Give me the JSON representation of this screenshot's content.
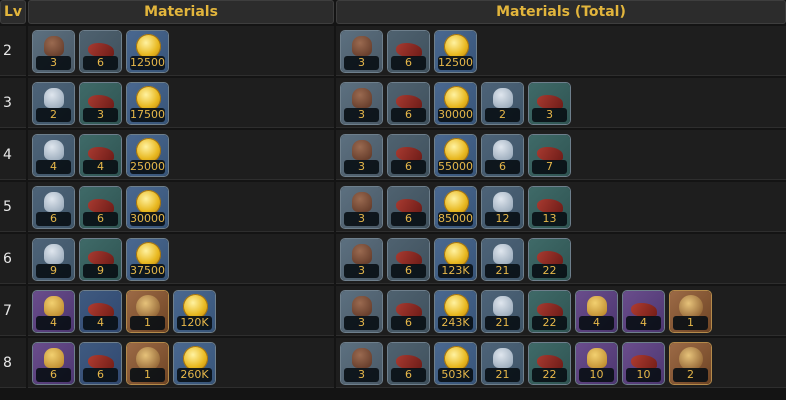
{
  "header": {
    "lv": "Lv",
    "materials": "Materials",
    "total": "Materials (Total)"
  },
  "rows": [
    {
      "lv": "2",
      "materials": [
        {
          "icon": "helmet-bronze-icon",
          "style": "helmet",
          "qty": "3"
        },
        {
          "icon": "red-boot-icon",
          "style": "boot",
          "qty": "6"
        },
        {
          "icon": "gold-coin-icon",
          "style": "coin",
          "qty": "12500"
        }
      ],
      "total": [
        {
          "icon": "helmet-bronze-icon",
          "style": "helmet",
          "qty": "3"
        },
        {
          "icon": "red-boot-icon",
          "style": "boot",
          "qty": "6"
        },
        {
          "icon": "gold-coin-icon",
          "style": "coin",
          "qty": "12500"
        }
      ]
    },
    {
      "lv": "3",
      "materials": [
        {
          "icon": "helmet-silver-icon",
          "style": "helmet-s",
          "qty": "2"
        },
        {
          "icon": "red-boot-teal-icon",
          "style": "boot-t",
          "qty": "3"
        },
        {
          "icon": "gold-coin-icon",
          "style": "coin",
          "qty": "17500"
        }
      ],
      "total": [
        {
          "icon": "helmet-bronze-icon",
          "style": "helmet",
          "qty": "3"
        },
        {
          "icon": "red-boot-icon",
          "style": "boot",
          "qty": "6"
        },
        {
          "icon": "gold-coin-icon",
          "style": "coin",
          "qty": "30000"
        },
        {
          "icon": "helmet-silver-icon",
          "style": "helmet-s",
          "qty": "2"
        },
        {
          "icon": "red-boot-teal-icon",
          "style": "boot-t",
          "qty": "3"
        }
      ]
    },
    {
      "lv": "4",
      "materials": [
        {
          "icon": "helmet-silver-icon",
          "style": "helmet-s",
          "qty": "4"
        },
        {
          "icon": "red-boot-teal-icon",
          "style": "boot-t",
          "qty": "4"
        },
        {
          "icon": "gold-coin-icon",
          "style": "coin",
          "qty": "25000"
        }
      ],
      "total": [
        {
          "icon": "helmet-bronze-icon",
          "style": "helmet",
          "qty": "3"
        },
        {
          "icon": "red-boot-icon",
          "style": "boot",
          "qty": "6"
        },
        {
          "icon": "gold-coin-icon",
          "style": "coin",
          "qty": "55000"
        },
        {
          "icon": "helmet-silver-icon",
          "style": "helmet-s",
          "qty": "6"
        },
        {
          "icon": "red-boot-teal-icon",
          "style": "boot-t",
          "qty": "7"
        }
      ]
    },
    {
      "lv": "5",
      "materials": [
        {
          "icon": "helmet-silver-icon",
          "style": "helmet-s",
          "qty": "6"
        },
        {
          "icon": "red-boot-teal-icon",
          "style": "boot-t",
          "qty": "6"
        },
        {
          "icon": "gold-coin-icon",
          "style": "coin",
          "qty": "30000"
        }
      ],
      "total": [
        {
          "icon": "helmet-bronze-icon",
          "style": "helmet",
          "qty": "3"
        },
        {
          "icon": "red-boot-icon",
          "style": "boot",
          "qty": "6"
        },
        {
          "icon": "gold-coin-icon",
          "style": "coin",
          "qty": "85000"
        },
        {
          "icon": "helmet-silver-icon",
          "style": "helmet-s",
          "qty": "12"
        },
        {
          "icon": "red-boot-teal-icon",
          "style": "boot-t",
          "qty": "13"
        }
      ]
    },
    {
      "lv": "6",
      "materials": [
        {
          "icon": "helmet-silver-icon",
          "style": "helmet-s",
          "qty": "9"
        },
        {
          "icon": "red-boot-teal-icon",
          "style": "boot-t",
          "qty": "9"
        },
        {
          "icon": "gold-coin-icon",
          "style": "coin",
          "qty": "37500"
        }
      ],
      "total": [
        {
          "icon": "helmet-bronze-icon",
          "style": "helmet",
          "qty": "3"
        },
        {
          "icon": "red-boot-icon",
          "style": "boot",
          "qty": "6"
        },
        {
          "icon": "gold-coin-icon",
          "style": "coin",
          "qty": "123K"
        },
        {
          "icon": "helmet-silver-icon",
          "style": "helmet-s",
          "qty": "21"
        },
        {
          "icon": "red-boot-teal-icon",
          "style": "boot-t",
          "qty": "22"
        }
      ]
    },
    {
      "lv": "7",
      "materials": [
        {
          "icon": "helmet-gold-icon",
          "style": "helmet-g",
          "qty": "4"
        },
        {
          "icon": "red-boot-blue-icon",
          "style": "boot-b",
          "qty": "4"
        },
        {
          "icon": "knight-helmet-icon",
          "style": "knight",
          "qty": "1",
          "rare": true
        },
        {
          "icon": "gold-coin-icon",
          "style": "coin",
          "qty": "120K"
        }
      ],
      "total": [
        {
          "icon": "helmet-bronze-icon",
          "style": "helmet",
          "qty": "3"
        },
        {
          "icon": "red-boot-icon",
          "style": "boot",
          "qty": "6"
        },
        {
          "icon": "gold-coin-icon",
          "style": "coin",
          "qty": "243K"
        },
        {
          "icon": "helmet-silver-icon",
          "style": "helmet-s",
          "qty": "21"
        },
        {
          "icon": "red-boot-teal-icon",
          "style": "boot-t",
          "qty": "22"
        },
        {
          "icon": "helmet-gold-icon",
          "style": "helmet-g",
          "qty": "4"
        },
        {
          "icon": "red-boot-purple-icon",
          "style": "boot-p",
          "qty": "4"
        },
        {
          "icon": "knight-helmet-icon",
          "style": "knight",
          "qty": "1",
          "rare": true
        }
      ]
    },
    {
      "lv": "8",
      "materials": [
        {
          "icon": "helmet-gold-icon",
          "style": "helmet-g",
          "qty": "6"
        },
        {
          "icon": "red-boot-blue-icon",
          "style": "boot-b",
          "qty": "6"
        },
        {
          "icon": "knight-helmet-icon",
          "style": "knight",
          "qty": "1",
          "rare": true
        },
        {
          "icon": "gold-coin-icon",
          "style": "coin",
          "qty": "260K"
        }
      ],
      "total": [
        {
          "icon": "helmet-bronze-icon",
          "style": "helmet",
          "qty": "3"
        },
        {
          "icon": "red-boot-icon",
          "style": "boot",
          "qty": "6"
        },
        {
          "icon": "gold-coin-icon",
          "style": "coin",
          "qty": "503K"
        },
        {
          "icon": "helmet-silver-icon",
          "style": "helmet-s",
          "qty": "21"
        },
        {
          "icon": "red-boot-teal-icon",
          "style": "boot-t",
          "qty": "22"
        },
        {
          "icon": "helmet-gold-icon",
          "style": "helmet-g",
          "qty": "10"
        },
        {
          "icon": "red-boot-purple-icon",
          "style": "boot-p",
          "qty": "10"
        },
        {
          "icon": "knight-helmet-icon",
          "style": "knight",
          "qty": "2",
          "rare": true
        }
      ]
    }
  ]
}
